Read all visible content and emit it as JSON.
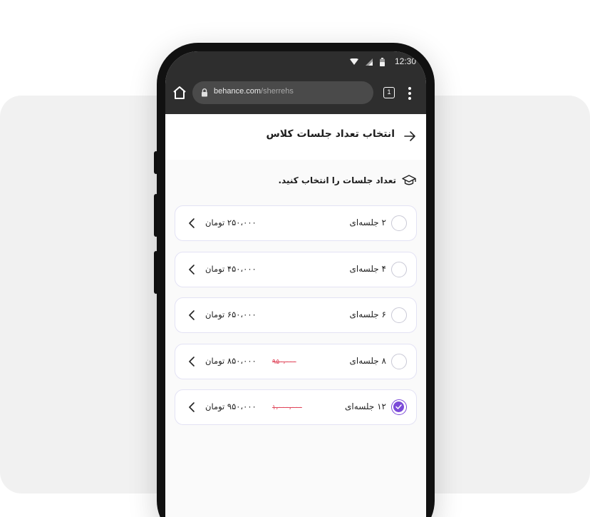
{
  "status_bar": {
    "time": "12:30"
  },
  "browser": {
    "url_domain": "behance.com",
    "url_path": "/sherrehs",
    "tab_count": "1"
  },
  "header": {
    "title": "انتخاب تعداد جلسات کلاس"
  },
  "section": {
    "title": "تعداد جلسات را انتخاب کنید."
  },
  "options": [
    {
      "sessions": "۲ جلسه‌ای",
      "price": "۲۵۰،۰۰۰ تومان",
      "old_price": "",
      "selected": false
    },
    {
      "sessions": "۴ جلسه‌ای",
      "price": "۴۵۰،۰۰۰ تومان",
      "old_price": "",
      "selected": false
    },
    {
      "sessions": "۶ جلسه‌ای",
      "price": "۶۵۰،۰۰۰ تومان",
      "old_price": "",
      "selected": false
    },
    {
      "sessions": "۸ جلسه‌ای",
      "price": "۸۵۰،۰۰۰ تومان",
      "old_price": "۹۵۰،۰۰۰",
      "selected": false
    },
    {
      "sessions": "۱۲ جلسه‌ای",
      "price": "۹۵۰،۰۰۰ تومان",
      "old_price": "۱،۰۰۰،۰۰۰",
      "selected": true
    }
  ],
  "colors": {
    "accent": "#7b4ad8",
    "discount": "#e0455a",
    "browser_bar": "#2e2e2e"
  },
  "icons": [
    "wifi-icon",
    "signal-icon",
    "battery-icon",
    "home-icon",
    "lock-icon",
    "tabs-icon",
    "more-vert-icon",
    "arrow-right-icon",
    "graduation-cap-icon",
    "chevron-left-icon",
    "check-icon"
  ]
}
